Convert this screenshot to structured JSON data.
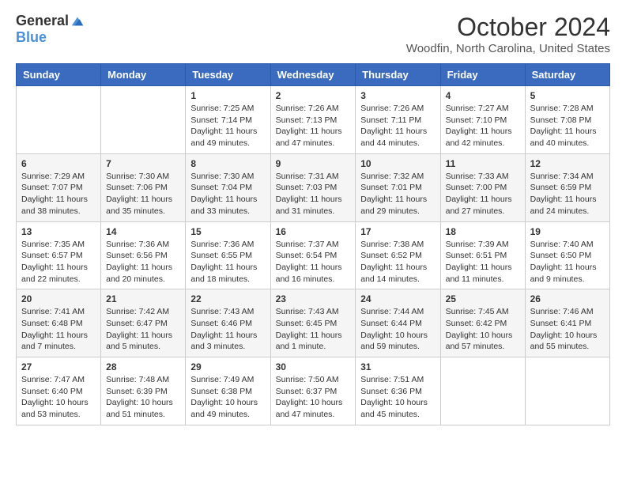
{
  "logo": {
    "general": "General",
    "blue": "Blue"
  },
  "title": "October 2024",
  "location": "Woodfin, North Carolina, United States",
  "days_of_week": [
    "Sunday",
    "Monday",
    "Tuesday",
    "Wednesday",
    "Thursday",
    "Friday",
    "Saturday"
  ],
  "weeks": [
    [
      {
        "day": "",
        "sunrise": "",
        "sunset": "",
        "daylight": ""
      },
      {
        "day": "",
        "sunrise": "",
        "sunset": "",
        "daylight": ""
      },
      {
        "day": "1",
        "sunrise": "Sunrise: 7:25 AM",
        "sunset": "Sunset: 7:14 PM",
        "daylight": "Daylight: 11 hours and 49 minutes."
      },
      {
        "day": "2",
        "sunrise": "Sunrise: 7:26 AM",
        "sunset": "Sunset: 7:13 PM",
        "daylight": "Daylight: 11 hours and 47 minutes."
      },
      {
        "day": "3",
        "sunrise": "Sunrise: 7:26 AM",
        "sunset": "Sunset: 7:11 PM",
        "daylight": "Daylight: 11 hours and 44 minutes."
      },
      {
        "day": "4",
        "sunrise": "Sunrise: 7:27 AM",
        "sunset": "Sunset: 7:10 PM",
        "daylight": "Daylight: 11 hours and 42 minutes."
      },
      {
        "day": "5",
        "sunrise": "Sunrise: 7:28 AM",
        "sunset": "Sunset: 7:08 PM",
        "daylight": "Daylight: 11 hours and 40 minutes."
      }
    ],
    [
      {
        "day": "6",
        "sunrise": "Sunrise: 7:29 AM",
        "sunset": "Sunset: 7:07 PM",
        "daylight": "Daylight: 11 hours and 38 minutes."
      },
      {
        "day": "7",
        "sunrise": "Sunrise: 7:30 AM",
        "sunset": "Sunset: 7:06 PM",
        "daylight": "Daylight: 11 hours and 35 minutes."
      },
      {
        "day": "8",
        "sunrise": "Sunrise: 7:30 AM",
        "sunset": "Sunset: 7:04 PM",
        "daylight": "Daylight: 11 hours and 33 minutes."
      },
      {
        "day": "9",
        "sunrise": "Sunrise: 7:31 AM",
        "sunset": "Sunset: 7:03 PM",
        "daylight": "Daylight: 11 hours and 31 minutes."
      },
      {
        "day": "10",
        "sunrise": "Sunrise: 7:32 AM",
        "sunset": "Sunset: 7:01 PM",
        "daylight": "Daylight: 11 hours and 29 minutes."
      },
      {
        "day": "11",
        "sunrise": "Sunrise: 7:33 AM",
        "sunset": "Sunset: 7:00 PM",
        "daylight": "Daylight: 11 hours and 27 minutes."
      },
      {
        "day": "12",
        "sunrise": "Sunrise: 7:34 AM",
        "sunset": "Sunset: 6:59 PM",
        "daylight": "Daylight: 11 hours and 24 minutes."
      }
    ],
    [
      {
        "day": "13",
        "sunrise": "Sunrise: 7:35 AM",
        "sunset": "Sunset: 6:57 PM",
        "daylight": "Daylight: 11 hours and 22 minutes."
      },
      {
        "day": "14",
        "sunrise": "Sunrise: 7:36 AM",
        "sunset": "Sunset: 6:56 PM",
        "daylight": "Daylight: 11 hours and 20 minutes."
      },
      {
        "day": "15",
        "sunrise": "Sunrise: 7:36 AM",
        "sunset": "Sunset: 6:55 PM",
        "daylight": "Daylight: 11 hours and 18 minutes."
      },
      {
        "day": "16",
        "sunrise": "Sunrise: 7:37 AM",
        "sunset": "Sunset: 6:54 PM",
        "daylight": "Daylight: 11 hours and 16 minutes."
      },
      {
        "day": "17",
        "sunrise": "Sunrise: 7:38 AM",
        "sunset": "Sunset: 6:52 PM",
        "daylight": "Daylight: 11 hours and 14 minutes."
      },
      {
        "day": "18",
        "sunrise": "Sunrise: 7:39 AM",
        "sunset": "Sunset: 6:51 PM",
        "daylight": "Daylight: 11 hours and 11 minutes."
      },
      {
        "day": "19",
        "sunrise": "Sunrise: 7:40 AM",
        "sunset": "Sunset: 6:50 PM",
        "daylight": "Daylight: 11 hours and 9 minutes."
      }
    ],
    [
      {
        "day": "20",
        "sunrise": "Sunrise: 7:41 AM",
        "sunset": "Sunset: 6:48 PM",
        "daylight": "Daylight: 11 hours and 7 minutes."
      },
      {
        "day": "21",
        "sunrise": "Sunrise: 7:42 AM",
        "sunset": "Sunset: 6:47 PM",
        "daylight": "Daylight: 11 hours and 5 minutes."
      },
      {
        "day": "22",
        "sunrise": "Sunrise: 7:43 AM",
        "sunset": "Sunset: 6:46 PM",
        "daylight": "Daylight: 11 hours and 3 minutes."
      },
      {
        "day": "23",
        "sunrise": "Sunrise: 7:43 AM",
        "sunset": "Sunset: 6:45 PM",
        "daylight": "Daylight: 11 hours and 1 minute."
      },
      {
        "day": "24",
        "sunrise": "Sunrise: 7:44 AM",
        "sunset": "Sunset: 6:44 PM",
        "daylight": "Daylight: 10 hours and 59 minutes."
      },
      {
        "day": "25",
        "sunrise": "Sunrise: 7:45 AM",
        "sunset": "Sunset: 6:42 PM",
        "daylight": "Daylight: 10 hours and 57 minutes."
      },
      {
        "day": "26",
        "sunrise": "Sunrise: 7:46 AM",
        "sunset": "Sunset: 6:41 PM",
        "daylight": "Daylight: 10 hours and 55 minutes."
      }
    ],
    [
      {
        "day": "27",
        "sunrise": "Sunrise: 7:47 AM",
        "sunset": "Sunset: 6:40 PM",
        "daylight": "Daylight: 10 hours and 53 minutes."
      },
      {
        "day": "28",
        "sunrise": "Sunrise: 7:48 AM",
        "sunset": "Sunset: 6:39 PM",
        "daylight": "Daylight: 10 hours and 51 minutes."
      },
      {
        "day": "29",
        "sunrise": "Sunrise: 7:49 AM",
        "sunset": "Sunset: 6:38 PM",
        "daylight": "Daylight: 10 hours and 49 minutes."
      },
      {
        "day": "30",
        "sunrise": "Sunrise: 7:50 AM",
        "sunset": "Sunset: 6:37 PM",
        "daylight": "Daylight: 10 hours and 47 minutes."
      },
      {
        "day": "31",
        "sunrise": "Sunrise: 7:51 AM",
        "sunset": "Sunset: 6:36 PM",
        "daylight": "Daylight: 10 hours and 45 minutes."
      },
      {
        "day": "",
        "sunrise": "",
        "sunset": "",
        "daylight": ""
      },
      {
        "day": "",
        "sunrise": "",
        "sunset": "",
        "daylight": ""
      }
    ]
  ]
}
